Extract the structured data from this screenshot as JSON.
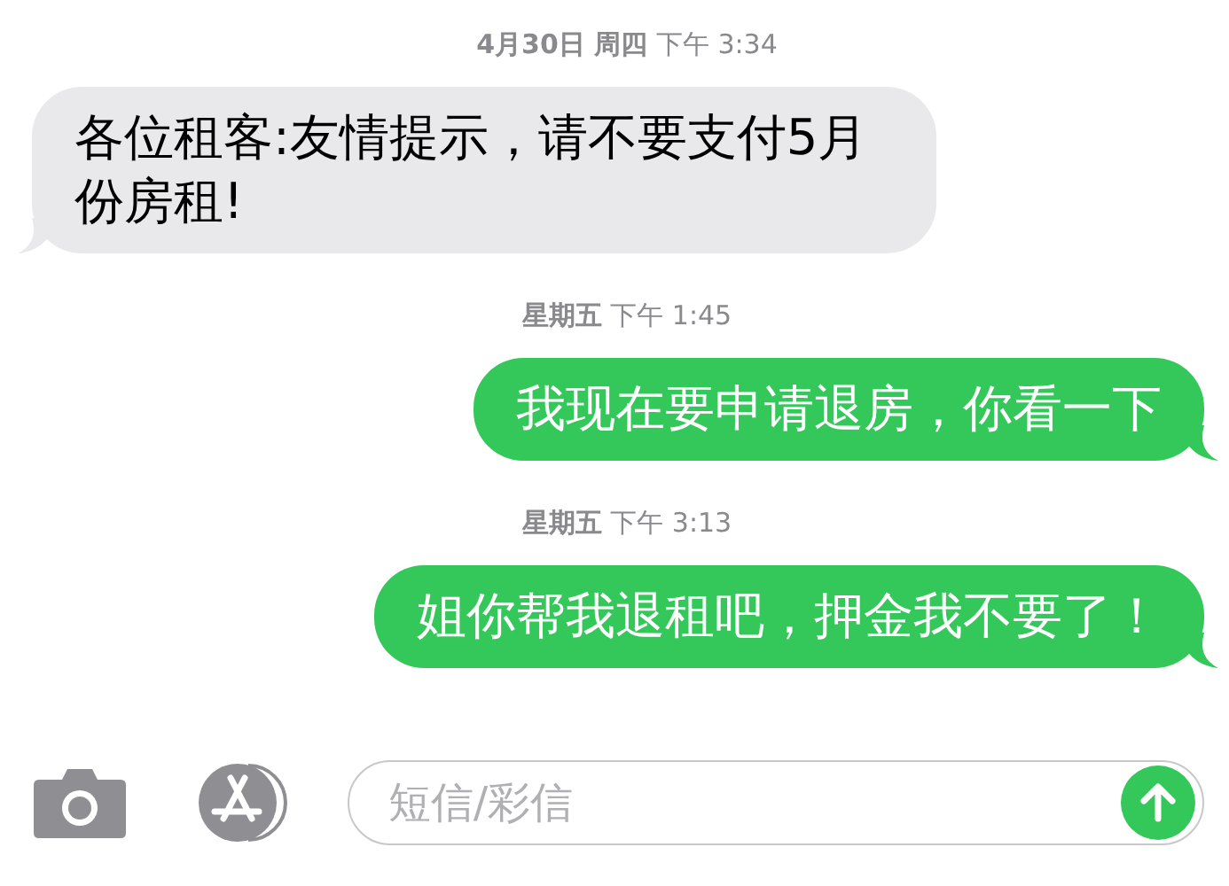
{
  "thread": [
    {
      "kind": "timestamp",
      "text": "**4月30日 周四** 下午 3:34"
    },
    {
      "kind": "incoming",
      "text": "各位租客:友情提示，请不要支付5月份房租!"
    },
    {
      "kind": "timestamp",
      "text": "**星期五** 下午 1:45"
    },
    {
      "kind": "outgoing",
      "text": "我现在要申请退房，你看一下"
    },
    {
      "kind": "timestamp",
      "text": "**星期五** 下午 3:13"
    },
    {
      "kind": "outgoing",
      "text": "姐你帮我退租吧，押金我不要了！"
    }
  ],
  "composer": {
    "placeholder": "短信/彩信"
  }
}
